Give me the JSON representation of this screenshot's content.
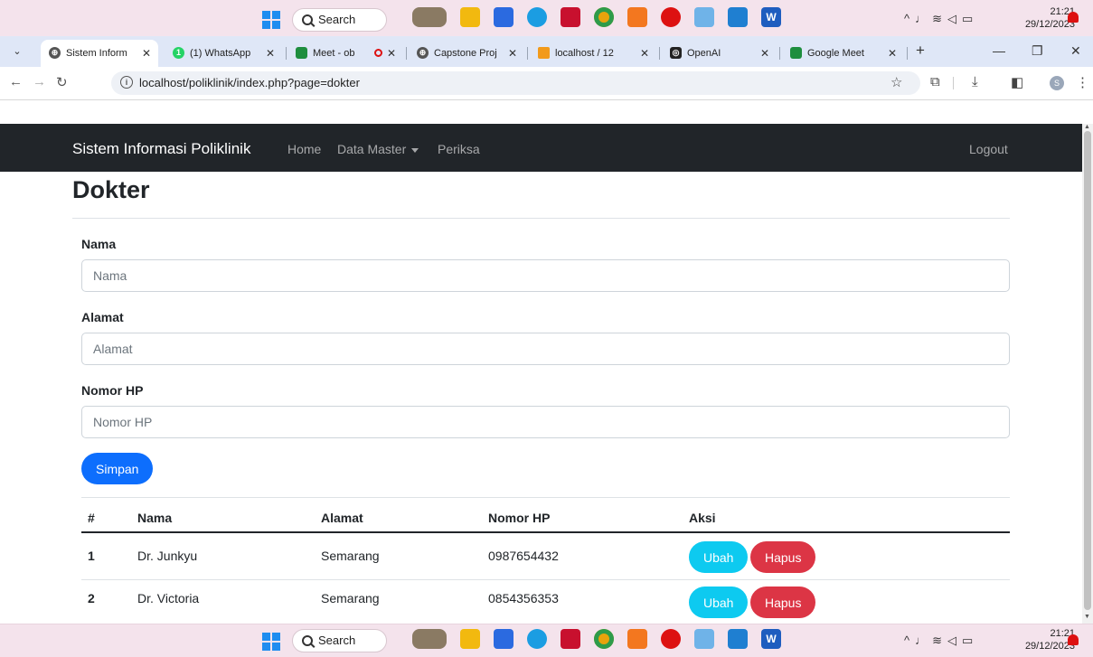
{
  "taskbar": {
    "search_label": "Search",
    "clock_time": "21:21",
    "clock_date": "29/12/2023",
    "tray_icons": [
      "chevron-up-icon",
      "microphone-icon",
      "wifi-icon",
      "volume-icon",
      "battery-icon"
    ],
    "apps": [
      {
        "name": "photo-app-icon",
        "color": "#8a7a63",
        "label": ""
      },
      {
        "name": "file-explorer-icon",
        "color": "#f2b90f",
        "label": ""
      },
      {
        "name": "store-icon",
        "color": "#2b6ae0",
        "label": ""
      },
      {
        "name": "edge-icon",
        "color": "#1b9de2",
        "label": ""
      },
      {
        "name": "mcafee-icon",
        "color": "#c8102e",
        "label": ""
      },
      {
        "name": "chrome-icon",
        "color": "#e8a30c",
        "label": ""
      },
      {
        "name": "xampp-icon",
        "color": "#f3771f",
        "label": ""
      },
      {
        "name": "obs-icon",
        "color": "#d11",
        "label": ""
      },
      {
        "name": "photos-icon",
        "color": "#6fb3e8",
        "label": ""
      },
      {
        "name": "vscode-icon",
        "color": "#1f7fd1",
        "label": ""
      },
      {
        "name": "word-icon",
        "color": "#1e5dbf",
        "label": "W"
      }
    ]
  },
  "browser": {
    "tabs": [
      {
        "title": "Sistem Inform",
        "icon": "globe-icon",
        "active": true
      },
      {
        "title": "(1) WhatsApp",
        "icon": "whatsapp-icon",
        "active": false
      },
      {
        "title": "Meet - ob",
        "icon": "google-meet-icon",
        "active": false
      },
      {
        "title": "Capstone Proj",
        "icon": "globe-icon",
        "active": false
      },
      {
        "title": "localhost / 12",
        "icon": "phpmyadmin-icon",
        "active": false
      },
      {
        "title": "OpenAI",
        "icon": "openai-icon",
        "active": false
      },
      {
        "title": "Google Meet",
        "icon": "google-meet-icon",
        "active": false
      }
    ],
    "new_tab_label": "+",
    "url": "localhost/poliklinik/index.php?page=dokter"
  },
  "navbar": {
    "brand": "Sistem Informasi Poliklinik",
    "links": [
      "Home",
      "Data Master",
      "Periksa"
    ],
    "logout": "Logout"
  },
  "page": {
    "title": "Dokter"
  },
  "form": {
    "nama": {
      "label": "Nama",
      "placeholder": "Nama",
      "value": ""
    },
    "alamat": {
      "label": "Alamat",
      "placeholder": "Alamat",
      "value": ""
    },
    "nomor_hp": {
      "label": "Nomor HP",
      "placeholder": "Nomor HP",
      "value": ""
    },
    "submit_label": "Simpan"
  },
  "table": {
    "headers": [
      "#",
      "Nama",
      "Alamat",
      "Nomor HP",
      "Aksi"
    ],
    "rows": [
      {
        "no": "1",
        "nama": "Dr. Junkyu",
        "alamat": "Semarang",
        "nomor_hp": "0987654432",
        "edit_label": "Ubah",
        "delete_label": "Hapus"
      },
      {
        "no": "2",
        "nama": "Dr. Victoria",
        "alamat": "Semarang",
        "nomor_hp": "0854356353",
        "edit_label": "Ubah",
        "delete_label": "Hapus"
      }
    ]
  },
  "colors": {
    "navbar_bg": "#212529",
    "primary": "#0d6efd",
    "info": "#0dcaf0",
    "danger": "#dc3545"
  }
}
